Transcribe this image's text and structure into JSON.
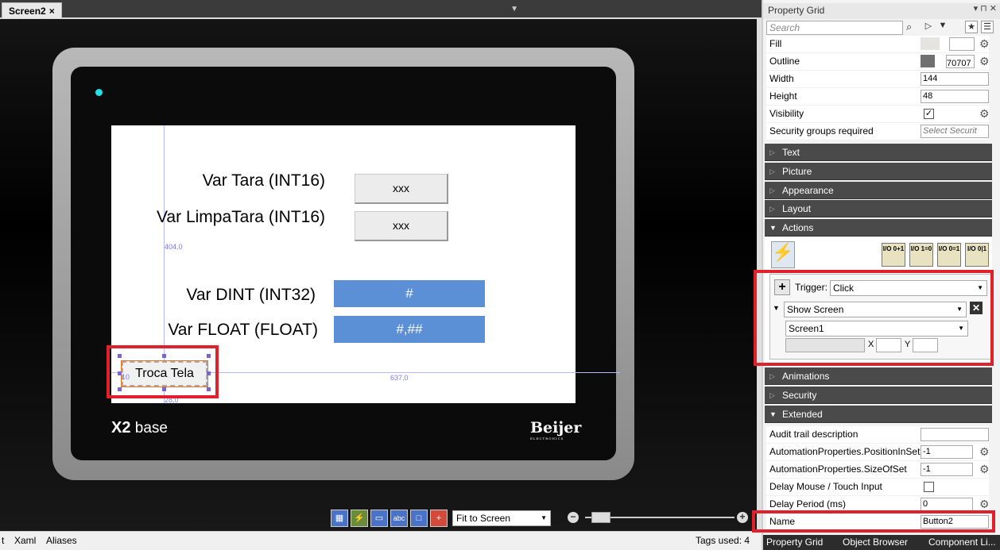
{
  "editor": {
    "tab_label": "Screen2",
    "tab_close": "×",
    "tab_menu": "▼"
  },
  "hmi": {
    "labels": [
      "Var Tara (INT16)",
      "Var LimpaTara (INT16)",
      "Var DINT (INT32)",
      "Var FLOAT (FLOAT)"
    ],
    "buttons": [
      "xxx",
      "xxx"
    ],
    "analog_boxes": [
      "#",
      "#,##"
    ],
    "nav_button": "Troca Tela",
    "dim_labels": [
      "404,0",
      "637,0",
      "28,0",
      "10"
    ],
    "brand_bold": "X2",
    "brand_light": "base",
    "maker": "Beijer",
    "maker_sub": "ELECTRONICS"
  },
  "toolbar": {
    "zoom_option": "Fit to Screen",
    "zoom_out": "−",
    "zoom_in": "+",
    "icons": [
      "grid-icon",
      "trigger-icon",
      "comment-icon",
      "abc-icon",
      "screen-icon",
      "layout-icon"
    ]
  },
  "status_bar": {
    "items": [
      "t",
      "Xaml",
      "Aliases"
    ],
    "tags_used": "Tags used: 4"
  },
  "property_grid": {
    "title": "Property Grid",
    "search_placeholder": "Search",
    "properties": [
      {
        "label": "Fill",
        "value": ""
      },
      {
        "label": "Outline",
        "value": "70707"
      },
      {
        "label": "Width",
        "value": "144"
      },
      {
        "label": "Height",
        "value": "48"
      },
      {
        "label": "Visibility",
        "value": "✓"
      },
      {
        "label": "Security groups required",
        "value": "Select Securit"
      }
    ],
    "sections": [
      "Text",
      "Picture",
      "Appearance",
      "Layout",
      "Actions"
    ],
    "actions": {
      "trigger_label": "Trigger:",
      "trigger_value": "Click",
      "action_value": "Show Screen",
      "screen_value": "Screen1",
      "x_label": "X",
      "y_label": "Y",
      "icon_labels": [
        "I/O 0+1",
        "I/O 1=0",
        "I/O 0=1",
        "I/O 0|1"
      ]
    },
    "sections2": [
      "Animations",
      "Security",
      "Extended"
    ],
    "extended": [
      {
        "label": "Audit trail description",
        "value": ""
      },
      {
        "label": "AutomationProperties.PositionInSet",
        "value": "-1"
      },
      {
        "label": "AutomationProperties.SizeOfSet",
        "value": "-1"
      },
      {
        "label": "Delay Mouse / Touch Input",
        "value": ""
      },
      {
        "label": "Delay Period (ms)",
        "value": "0"
      },
      {
        "label": "Name",
        "value": "Button2"
      }
    ],
    "bottom_tabs": [
      "Property Grid",
      "Object Browser",
      "Component Li..."
    ]
  },
  "colors": {
    "highlight": "#e0202a",
    "accent_box": "#5b8fd6",
    "led": "#22e0e8"
  }
}
